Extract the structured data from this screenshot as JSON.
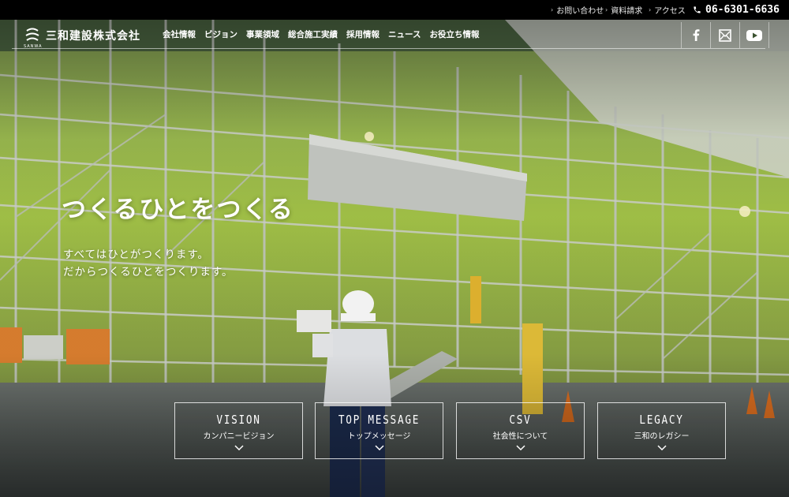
{
  "utility_bar": {
    "links": [
      {
        "label": "お問い合わせ"
      },
      {
        "label": "資料請求"
      },
      {
        "label": "アクセス"
      }
    ],
    "phone": "06-6301-6636"
  },
  "header": {
    "logo_sub": "SANWA",
    "company_name": "三和建設株式会社",
    "nav": [
      {
        "label": "会社情報"
      },
      {
        "label": "ビジョン"
      },
      {
        "label": "事業領域"
      },
      {
        "label": "総合施工実績"
      },
      {
        "label": "採用情報"
      },
      {
        "label": "ニュース"
      },
      {
        "label": "お役立ち情報"
      }
    ],
    "social": [
      "facebook-icon",
      "mail-icon",
      "youtube-icon"
    ]
  },
  "hero": {
    "headline": "つくるひとをつくる",
    "sub_line1": "すべてはひとがつくります。",
    "sub_line2": "だからつくるひとをつくります。"
  },
  "cards": [
    {
      "en": "VISION",
      "jp": "カンパニービジョン"
    },
    {
      "en": "TOP MESSAGE",
      "jp": "トップメッセージ"
    },
    {
      "en": "CSV",
      "jp": "社会性について"
    },
    {
      "en": "LEGACY",
      "jp": "三和のレガシー"
    }
  ],
  "colors": {
    "topbar": "#000000",
    "text": "#ffffff",
    "accent_green": "#b6d84a"
  }
}
